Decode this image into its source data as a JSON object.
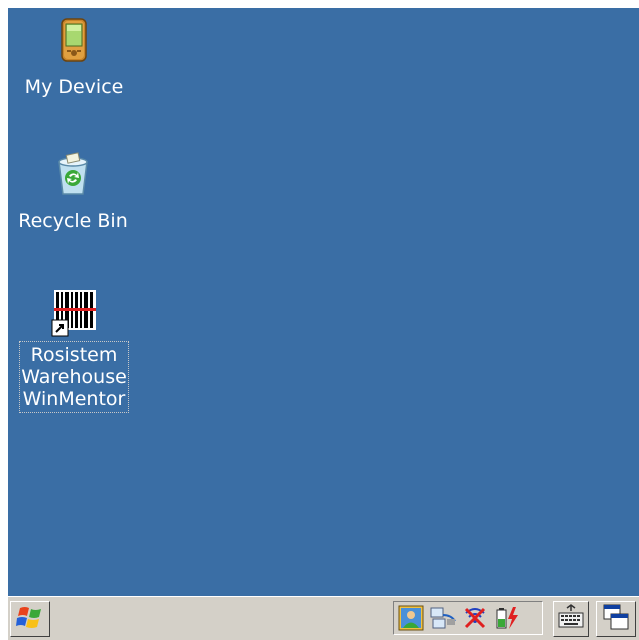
{
  "desktop": {
    "background_color": "#3a6ea5",
    "icons": [
      {
        "label": "My Device",
        "icon": "pda-device-icon"
      },
      {
        "label": "Recycle Bin",
        "icon": "recycle-bin-icon"
      },
      {
        "label": "Rosistem\nWarehouse\nWinMentor",
        "icon": "barcode-scanner-shortcut-icon",
        "selected": true
      }
    ]
  },
  "taskbar": {
    "start_icon": "windows-flag-icon",
    "tray_icons": [
      "contacts-icon",
      "network-icon",
      "wireless-off-icon",
      "battery-charging-icon"
    ],
    "keyboard_icon": "keyboard-icon",
    "switch_icon": "window-switcher-icon"
  }
}
